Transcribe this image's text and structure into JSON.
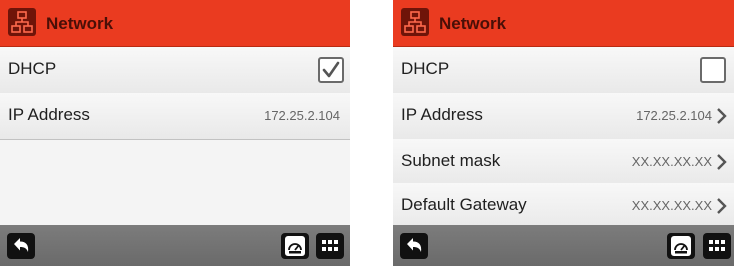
{
  "left_panel": {
    "header": {
      "title": "Network",
      "icon": "network-icon"
    },
    "rows": [
      {
        "label": "DHCP",
        "checked": true
      },
      {
        "label": "IP Address",
        "value": "172.25.2.104"
      }
    ],
    "footer": {
      "back_icon": "back-icon",
      "speed_icon": "speedometer-icon",
      "grid_icon": "keypad-icon"
    }
  },
  "right_panel": {
    "header": {
      "title": "Network",
      "icon": "network-icon"
    },
    "rows": [
      {
        "label": "DHCP",
        "checked": false
      },
      {
        "label": "IP Address",
        "value": "172.25.2.104"
      },
      {
        "label": "Subnet mask",
        "value": "XX.XX.XX.XX"
      },
      {
        "label": "Default Gateway",
        "value": "XX.XX.XX.XX"
      }
    ],
    "footer": {
      "back_icon": "back-icon",
      "speed_icon": "speedometer-icon",
      "grid_icon": "keypad-icon"
    }
  },
  "colors": {
    "header": "#ea3b20",
    "header_text": "#4a0f07",
    "footer": "#737373"
  }
}
